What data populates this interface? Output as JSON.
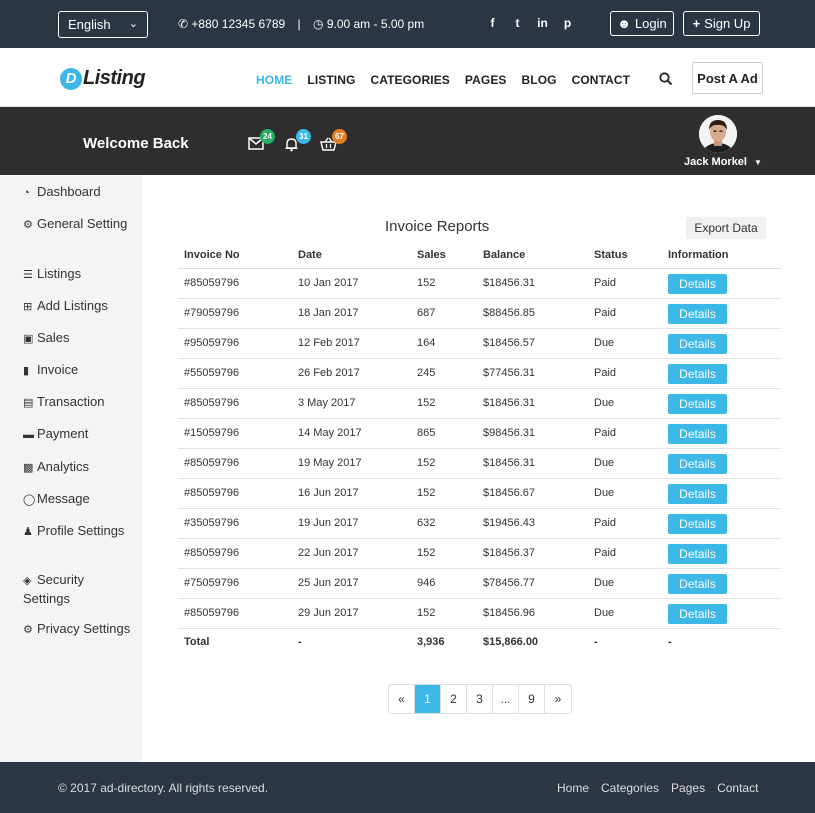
{
  "topbar": {
    "language": "English",
    "phone": "+880 12345 6789",
    "separator": "|",
    "hours": "9.00 am - 5.00 pm",
    "social_icons": [
      "facebook-icon",
      "twitter-icon",
      "linkedin-icon",
      "pinterest-icon"
    ],
    "login_label": "Login",
    "signup_label": "Sign Up"
  },
  "navbar": {
    "logo_letter": "D",
    "logo_text": "Listing",
    "links": [
      "HOME",
      "LISTING",
      "CATEGORIES",
      "PAGES",
      "BLOG",
      "CONTACT"
    ],
    "post_ad_label": "Post A Ad"
  },
  "welcome": {
    "title": "Welcome Back",
    "messages_count": "24",
    "notifications_count": "31",
    "cart_count": "67",
    "user_name": "Jack Morkel"
  },
  "sidebar": {
    "items": [
      {
        "label": "Dashboard",
        "icon": "dashboard-icon"
      },
      {
        "label": "General Setting",
        "icon": "gear-icon"
      },
      {
        "label": "Listings",
        "icon": "list-icon"
      },
      {
        "label": "Add Listings",
        "icon": "plus-square-icon"
      },
      {
        "label": "Sales",
        "icon": "cart-icon"
      },
      {
        "label": "Invoice",
        "icon": "file-icon"
      },
      {
        "label": "Transaction",
        "icon": "money-icon"
      },
      {
        "label": "Payment",
        "icon": "credit-card-icon"
      },
      {
        "label": "Analytics",
        "icon": "bar-chart-icon"
      },
      {
        "label": "Message",
        "icon": "comment-icon"
      },
      {
        "label": "Profile Settings",
        "icon": "user-icon"
      },
      {
        "label": "Security Settings",
        "icon": "lock-icon"
      },
      {
        "label": "Privacy Settings",
        "icon": "gear-icon"
      }
    ]
  },
  "report": {
    "title": "Invoice Reports",
    "export_label": "Export Data",
    "columns": [
      "Invoice No",
      "Date",
      "Sales",
      "Balance",
      "Status",
      "Information"
    ],
    "details_label": "Details",
    "rows": [
      {
        "invoice": "#85059796",
        "date": "10 Jan 2017",
        "sales": "152",
        "balance": "$18456.31",
        "status": "Paid"
      },
      {
        "invoice": "#79059796",
        "date": "18 Jan 2017",
        "sales": "687",
        "balance": "$88456.85",
        "status": "Paid"
      },
      {
        "invoice": "#95059796",
        "date": "12 Feb 2017",
        "sales": "164",
        "balance": "$18456.57",
        "status": "Due"
      },
      {
        "invoice": "#55059796",
        "date": "26 Feb 2017",
        "sales": "245",
        "balance": "$77456.31",
        "status": "Paid"
      },
      {
        "invoice": "#85059796",
        "date": "3 May 2017",
        "sales": "152",
        "balance": "$18456.31",
        "status": "Due"
      },
      {
        "invoice": "#15059796",
        "date": "14 May 2017",
        "sales": "865",
        "balance": "$98456.31",
        "status": "Paid"
      },
      {
        "invoice": "#85059796",
        "date": "19 May 2017",
        "sales": "152",
        "balance": "$18456.31",
        "status": "Due"
      },
      {
        "invoice": "#85059796",
        "date": "16 Jun 2017",
        "sales": "152",
        "balance": "$18456.67",
        "status": "Due"
      },
      {
        "invoice": "#35059796",
        "date": "19 Jun 2017",
        "sales": "632",
        "balance": "$19456.43",
        "status": "Paid"
      },
      {
        "invoice": "#85059796",
        "date": "22 Jun 2017",
        "sales": "152",
        "balance": "$18456.37",
        "status": "Paid"
      },
      {
        "invoice": "#75059796",
        "date": "25 Jun 2017",
        "sales": "946",
        "balance": "$78456.77",
        "status": "Due"
      },
      {
        "invoice": "#85059796",
        "date": "29 Jun 2017",
        "sales": "152",
        "balance": "$18456.96",
        "status": "Due"
      }
    ],
    "total": {
      "label": "Total",
      "date": "-",
      "sales": "3,936",
      "balance": "$15,866.00",
      "status": "-",
      "information": "-"
    }
  },
  "pagination": [
    "«",
    "1",
    "2",
    "3",
    "...",
    "9",
    "»"
  ],
  "pagination_active": "1",
  "footer": {
    "copyright": "© 2017 ad-directory. All rights reserved.",
    "links": [
      "Home",
      "Categories",
      "Pages",
      "Contact"
    ]
  },
  "colors": {
    "accent": "#3bb7e8",
    "topbar_bg": "#2c3544",
    "welcome_bg": "#2e2e2e",
    "badge_messages": "#27ae60",
    "badge_notifications": "#3bb7e8",
    "badge_cart": "#e67e22"
  }
}
